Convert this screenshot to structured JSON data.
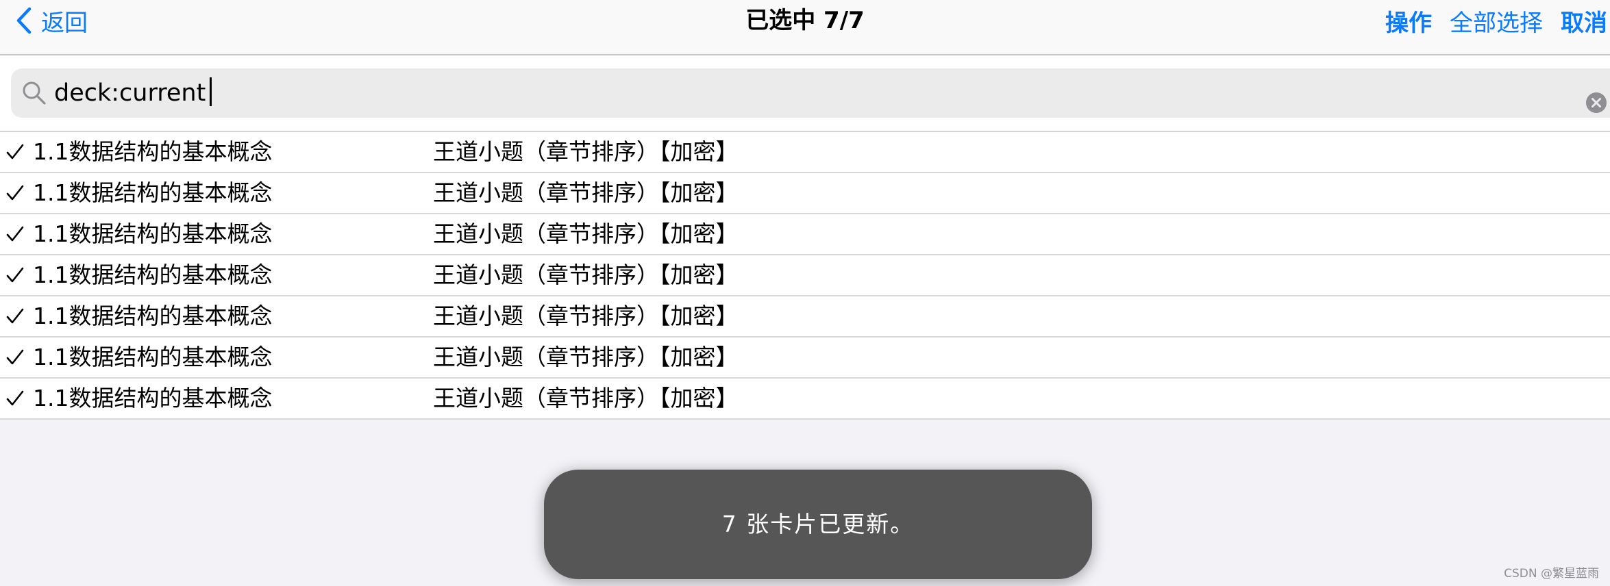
{
  "nav": {
    "back_label": "返回",
    "title": "已选中 7/7",
    "actions": [
      {
        "label": "操作",
        "bold": true
      },
      {
        "label": "全部选择",
        "bold": false
      },
      {
        "label": "取消",
        "bold": true
      }
    ]
  },
  "search": {
    "value": "deck:current",
    "placeholder": ""
  },
  "rows": [
    {
      "name": "1.1数据结构的基本概念",
      "deck": "王道小题（章节排序）【加密】",
      "selected": true
    },
    {
      "name": "1.1数据结构的基本概念",
      "deck": "王道小题（章节排序）【加密】",
      "selected": true
    },
    {
      "name": "1.1数据结构的基本概念",
      "deck": "王道小题（章节排序）【加密】",
      "selected": true
    },
    {
      "name": "1.1数据结构的基本概念",
      "deck": "王道小题（章节排序）【加密】",
      "selected": true
    },
    {
      "name": "1.1数据结构的基本概念",
      "deck": "王道小题（章节排序）【加密】",
      "selected": true
    },
    {
      "name": "1.1数据结构的基本概念",
      "deck": "王道小题（章节排序）【加密】",
      "selected": true
    },
    {
      "name": "1.1数据结构的基本概念",
      "deck": "王道小题（章节排序）【加密】",
      "selected": true
    }
  ],
  "toast": {
    "message": "7 张卡片已更新。"
  },
  "watermark": "CSDN @繁星蓝雨",
  "colors": {
    "accent": "#0a7aff",
    "toast_bg": "#565656",
    "page_bg": "#f2f2f7"
  },
  "icons": {
    "back": "chevron-left-icon",
    "search": "search-icon",
    "clear": "clear-icon",
    "check": "checkmark-icon"
  }
}
